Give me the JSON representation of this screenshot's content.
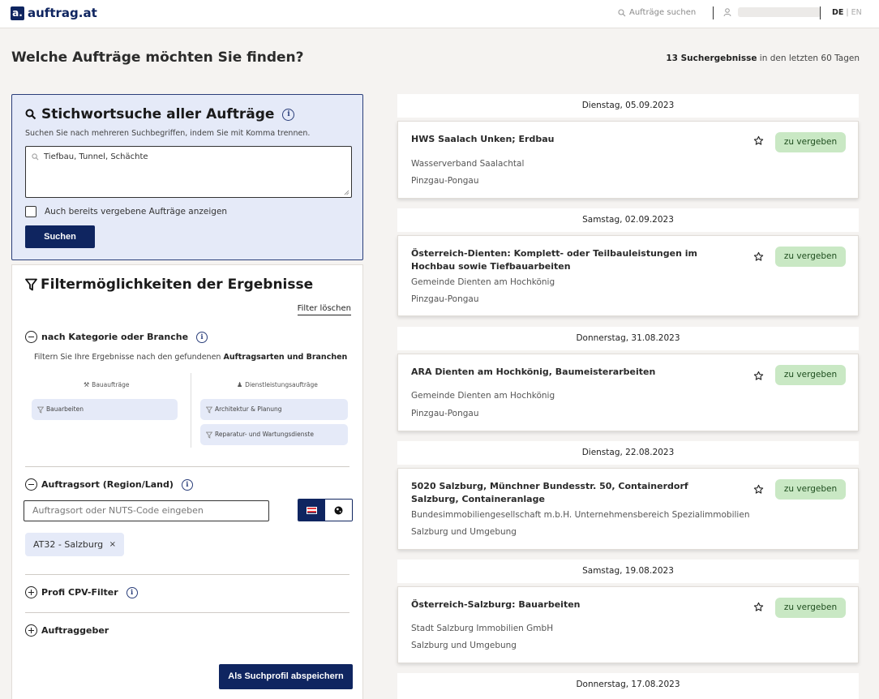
{
  "nav": {
    "logo_mark": "a.",
    "logo_text": "auftrag.at",
    "search_label": "Aufträge suchen",
    "lang_de": "DE",
    "lang_sep": "|",
    "lang_en": "EN"
  },
  "page": {
    "title": "Welche Aufträge möchten Sie finden?",
    "count": "13 Suchergebnisse",
    "count_suffix": " in den letzten 60 Tagen"
  },
  "keyword": {
    "title": "Stichwortsuche aller Aufträge",
    "info": "i",
    "hint": "Suchen Sie nach mehreren Suchbegriffen, indem Sie mit Komma trennen.",
    "value": "Tiefbau, Tunnel, Schächte",
    "checkbox_label": "Auch bereits vergebene Aufträge anzeigen",
    "button": "Suchen"
  },
  "filter": {
    "title": "Filtermöglichkeiten der Ergebnisse",
    "clear": "Filter löschen",
    "category": {
      "heading": "nach Kategorie oder Branche",
      "desc_prefix": "Filtern Sie Ihre Ergebnisse nach den gefundenen ",
      "desc_bold": "Auftragsarten und Branchen",
      "col1_title": "Bauaufträge",
      "col2_title": "Dienstleistungsaufträge",
      "col1_items": [
        "Bauarbeiten"
      ],
      "col2_items": [
        "Architektur & Planung",
        "Reparatur- und Wartungsdienste"
      ]
    },
    "location": {
      "heading": "Auftragsort (Region/Land)",
      "placeholder": "Auftragsort oder NUTS-Code eingeben",
      "tag": "AT32 - Salzburg",
      "tag_remove": "×"
    },
    "cpv": {
      "heading": "Profi CPV-Filter"
    },
    "client": {
      "heading": "Auftraggeber"
    },
    "save_button": "Als Suchprofil abspeichern"
  },
  "colors": {
    "primary": "#0f2560",
    "search_bg": "#e5eaf8",
    "status_bg": "#c9e8c4",
    "page_bg": "#f5f3f1"
  },
  "results": [
    {
      "date": "Dienstag, 05.09.2023",
      "title": "HWS Saalach Unken; Erdbau",
      "org": "Wasserverband Saalachtal",
      "region": "Pinzgau-Pongau",
      "status": "zu vergeben"
    },
    {
      "date": "Samstag, 02.09.2023",
      "title": "Österreich-Dienten: Komplett- oder Teilbauleistungen im Hochbau sowie Tiefbauarbeiten",
      "org": "Gemeinde Dienten am Hochkönig",
      "region": "Pinzgau-Pongau",
      "status": "zu vergeben"
    },
    {
      "date": "Donnerstag, 31.08.2023",
      "title": "ARA Dienten am Hochkönig, Baumeisterarbeiten",
      "org": "Gemeinde Dienten am Hochkönig",
      "region": "Pinzgau-Pongau",
      "status": "zu vergeben"
    },
    {
      "date": "Dienstag, 22.08.2023",
      "title": "5020 Salzburg, Münchner Bundesstr. 50, Containerdorf Salzburg, Containeranlage",
      "org": "Bundesimmobiliengesellschaft m.b.H. Unternehmensbereich Spezialimmobilien",
      "region": "Salzburg und Umgebung",
      "status": "zu vergeben"
    },
    {
      "date": "Samstag, 19.08.2023",
      "title": "Österreich-Salzburg: Bauarbeiten",
      "org": "Stadt Salzburg Immobilien GmbH",
      "region": "Salzburg und Umgebung",
      "status": "zu vergeben"
    },
    {
      "date": "Donnerstag, 17.08.2023"
    }
  ]
}
